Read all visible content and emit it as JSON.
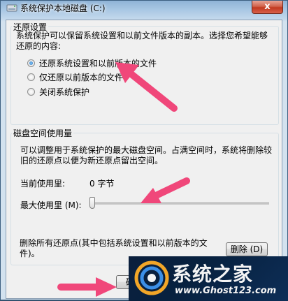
{
  "window": {
    "title": "系统保护本地磁盘 (C:)",
    "close_glyph": "x"
  },
  "restore": {
    "group_title": "还原设置",
    "description": "系统保护可以保留系统设置和以前文件版本的副本。选择您希望能够还原的内容:",
    "options": [
      {
        "label": "还原系统设置和以前版本的文件",
        "checked": true
      },
      {
        "label": "仅还原以前版本的文件",
        "checked": false
      },
      {
        "label": "关闭系统保护",
        "checked": false
      }
    ]
  },
  "disk": {
    "group_title": "磁盘空间使用量",
    "description": "可以调整用于系统保护的最大磁盘空间。占满空间时，系统将删除较旧的还原点以便为新还原点留出空间。",
    "current_usage_label": "当前使用里:",
    "current_usage_value": "0 字节",
    "max_usage_label": "最大使用里 (M):",
    "slider_level": 0
  },
  "delete": {
    "text": "删除所有还原点(其中包括系统设置和以前版本的文件)。",
    "button_label": "删除 (D)"
  },
  "footer": {
    "ok_label": "确"
  },
  "watermark": {
    "title": "系统之家",
    "url": "www.Ghost123.com"
  },
  "colors": {
    "arrow": "#f0477a",
    "accent": "#1a66b5"
  }
}
